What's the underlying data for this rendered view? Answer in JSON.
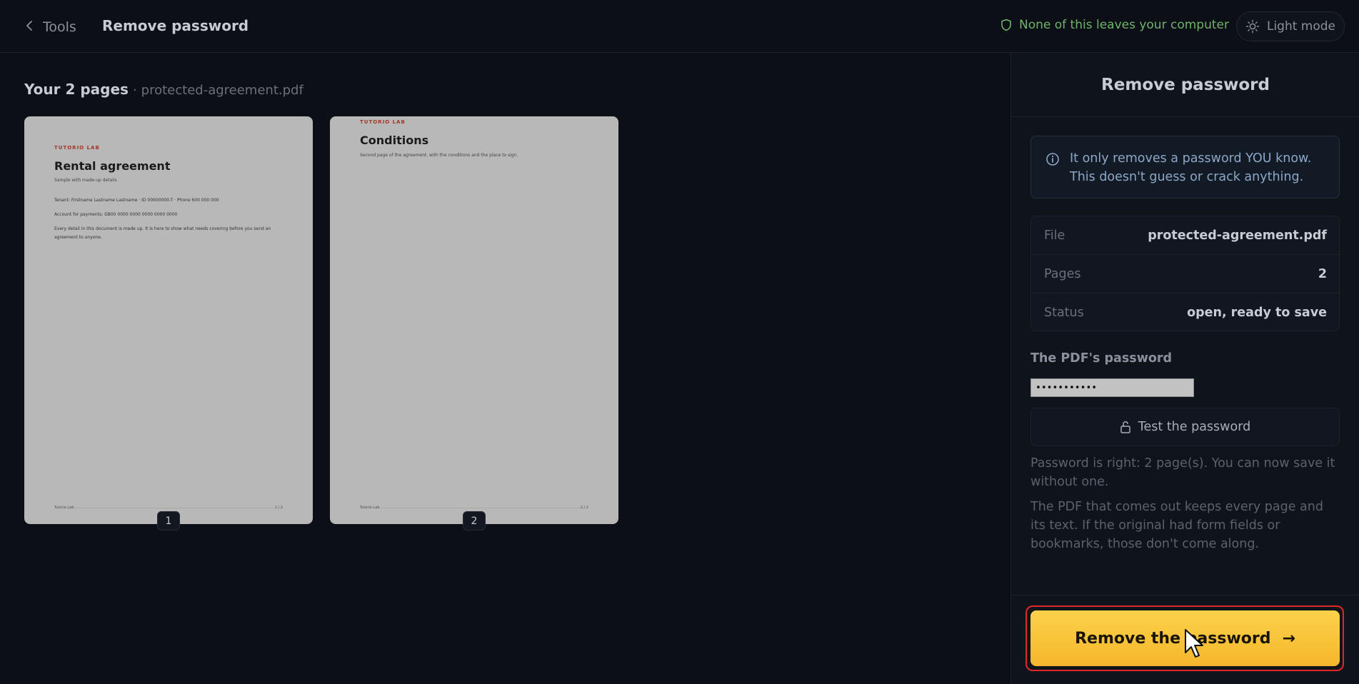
{
  "header": {
    "back_label": "Tools",
    "title": "Remove password",
    "privacy_text": "None of this leaves your computer",
    "theme_toggle_label": "Light mode"
  },
  "workspace": {
    "heading": "Your 2 pages",
    "separator": "·",
    "filename": "protected-agreement.pdf",
    "pages": [
      {
        "number": "1",
        "brand": "TUTORIO LAB",
        "title": "Rental agreement",
        "subtitle": "Sample with made-up details",
        "lines": [
          "Tenant: Firstname Lastname Lastname · ID 00000000-T · Phone 600 000 000",
          "Account for payments: GB00 0000 0000 0000 0000 0000",
          "Every detail in this document is made up. It is here to show what needs covering before you send an agreement to anyone."
        ],
        "footer_left": "Tutorio Lab",
        "footer_right": "1 / 2"
      },
      {
        "number": "2",
        "brand": "TUTORIO LAB",
        "title": "Conditions",
        "subtitle": "Second page of the agreement, with the conditions and the place to sign.",
        "footer_left": "Tutorio Lab",
        "footer_right": "2 / 2"
      }
    ]
  },
  "panel": {
    "title": "Remove password",
    "info": "It only removes a password YOU know. This doesn't guess or crack anything.",
    "meta": [
      {
        "key": "File",
        "value": "protected-agreement.pdf"
      },
      {
        "key": "Pages",
        "value": "2"
      },
      {
        "key": "Status",
        "value": "open, ready to save"
      }
    ],
    "password_label": "The PDF's password",
    "password_value": "•••••••••••",
    "test_button": "Test the password",
    "result_message": "Password is right: 2 page(s). You can now save it without one.",
    "note": "The PDF that comes out keeps every page and its text. If the original had form fields or bookmarks, those don't come along.",
    "primary_button": "Remove the password",
    "primary_arrow": "→"
  },
  "colors": {
    "background": "#0c0f16",
    "accent": "#f6b62c",
    "privacy_green": "#6fb36a",
    "highlight_ring": "#e0282a"
  },
  "icons": {
    "back": "chevron-left-icon",
    "privacy": "shield-icon",
    "theme": "sun-icon",
    "info": "info-icon",
    "test": "unlock-icon",
    "cta": "arrow-right-icon"
  }
}
